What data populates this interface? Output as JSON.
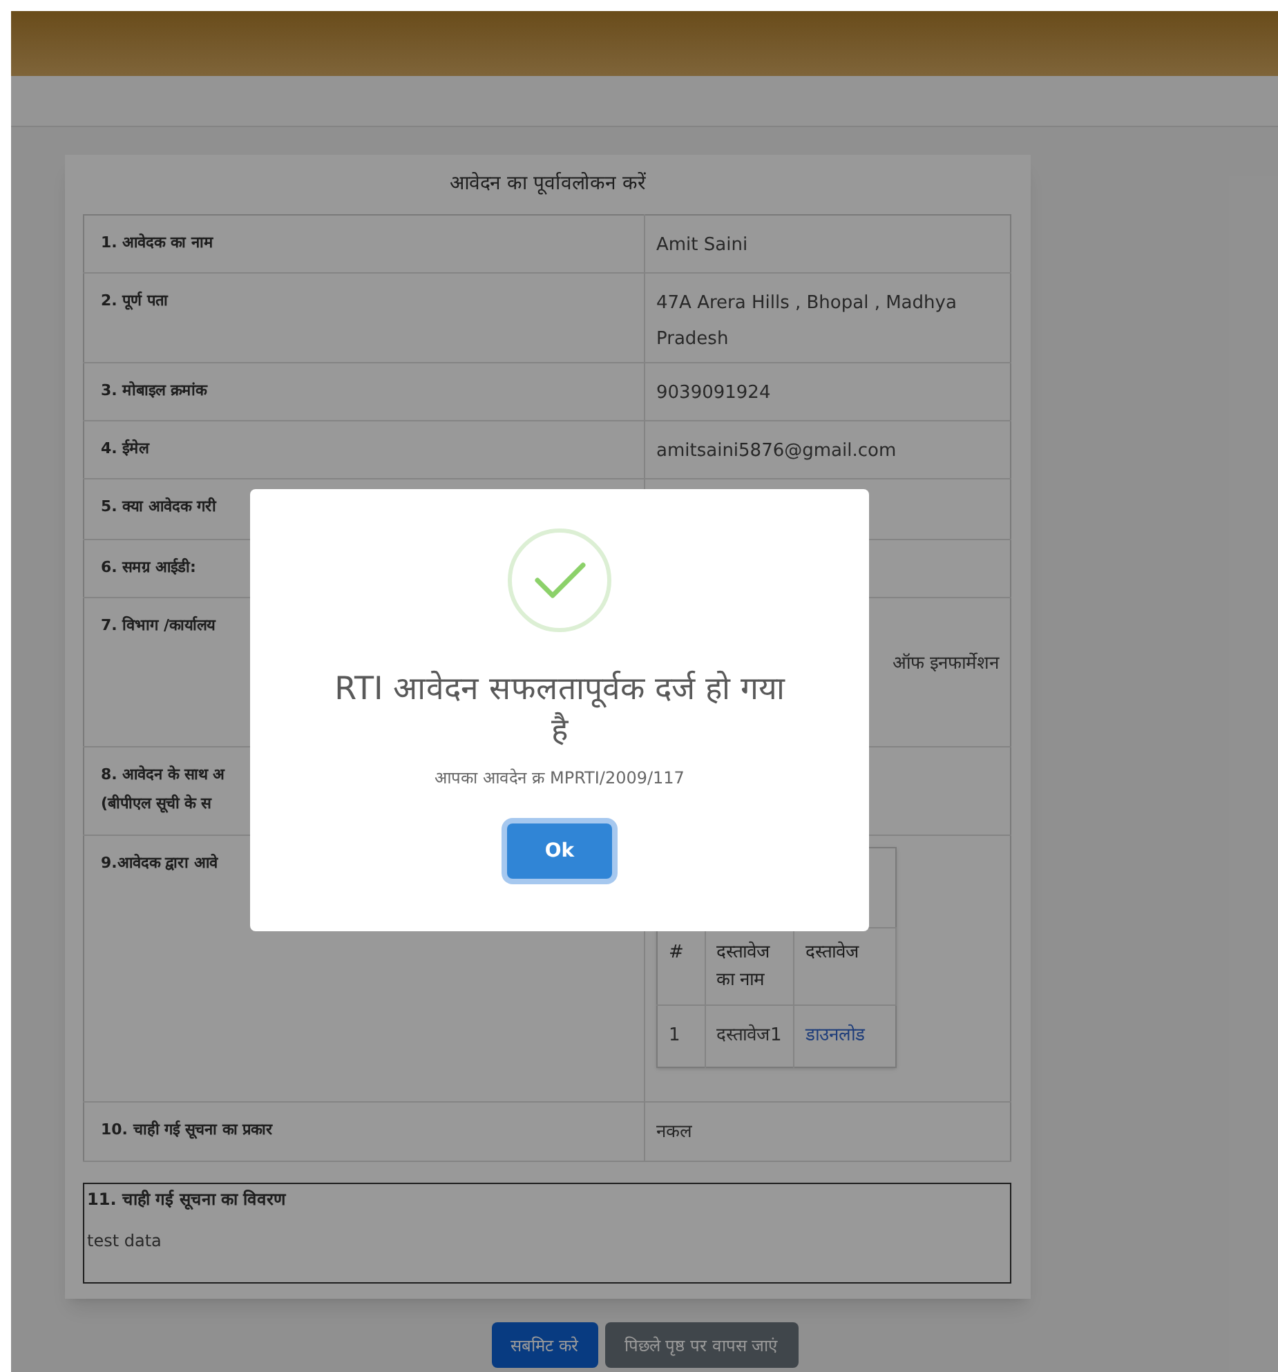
{
  "page_title": "आवेदन का पूर्वावलोकन करें",
  "rows": [
    {
      "kind": "text",
      "label": "1. आवेदक का नाम",
      "value": "Amit Saini"
    },
    {
      "kind": "text",
      "label": "2. पूर्ण पता",
      "value": "47A Arera Hills , Bhopal , Madhya Pradesh"
    },
    {
      "kind": "text",
      "label": "3. मोबाइल क्रमांक",
      "value": "9039091924"
    },
    {
      "kind": "text",
      "label": "4. ईमेल",
      "value": "amitsaini5876@gmail.com"
    },
    {
      "kind": "text",
      "label": "5. क्या आवेदक गरी"
    },
    {
      "kind": "text",
      "label": "6. समग्र आईडी:"
    },
    {
      "kind": "tail",
      "label": "7. विभाग /कार्यालय",
      "value": "ऑफ इनफार्मेशन"
    },
    {
      "kind": "text",
      "label": "8. आवेदन के साथ अ",
      "label_2": "(बीपीएल सूची के स"
    },
    {
      "kind": "documents",
      "label": "9.आवेदक द्वारा आवे",
      "columns": [
        "#",
        "दस्तावेज का नाम",
        "दस्तावेज"
      ],
      "docs": [
        {
          "number": "1",
          "name": "दस्तावेज1",
          "link": "डाउनलोड"
        }
      ]
    },
    {
      "kind": "text",
      "label": "10. चाही गई सूचना का प्रकार",
      "value": "नकल"
    }
  ],
  "details": {
    "label": "11. चाही गई सूचना का विवरण",
    "value": "test data"
  },
  "buttons": [
    {
      "label": "सबमिट करे",
      "kind": "primary"
    },
    {
      "label": "पिछले पृष्ठ पर वापस जाएं",
      "kind": "secondary"
    }
  ],
  "dialog": {
    "title": "RTI आवेदन सफलतापूर्वक दर्ज हो गया है",
    "message": "आपका आवदेन क्र MPRTI/2009/117",
    "button": "Ok"
  }
}
